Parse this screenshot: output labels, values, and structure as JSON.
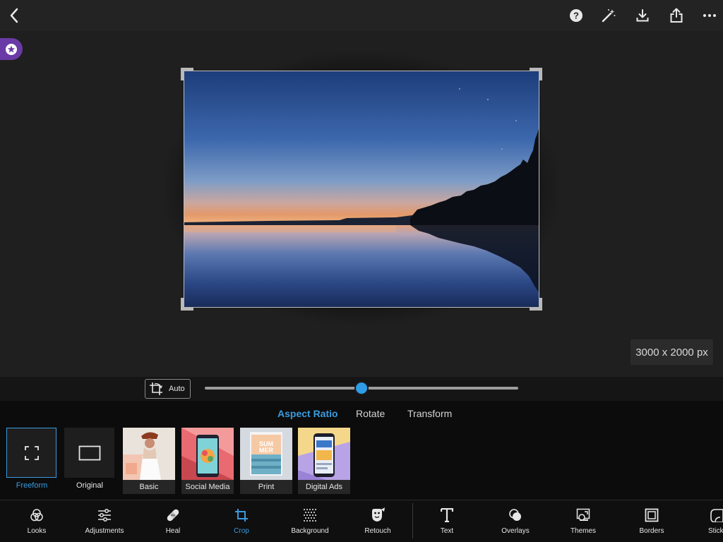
{
  "canvas": {
    "image_dimensions": "3000 x 2000 px"
  },
  "straighten": {
    "auto_label": "Auto",
    "slider_value": 0.5
  },
  "crop_tabs": [
    {
      "label": "Aspect Ratio",
      "active": true
    },
    {
      "label": "Rotate",
      "active": false
    },
    {
      "label": "Transform",
      "active": false
    }
  ],
  "ratios": [
    {
      "label": "Freeform",
      "selected": true
    },
    {
      "label": "Original",
      "selected": false
    }
  ],
  "presets": [
    {
      "label": "Basic"
    },
    {
      "label": "Social Media"
    },
    {
      "label": "Print"
    },
    {
      "label": "Digital Ads"
    }
  ],
  "preset_art": {
    "print_poster_text_1": "SUM",
    "print_poster_text_2": "MER"
  },
  "tools": [
    {
      "label": "Looks",
      "icon": "looks-icon"
    },
    {
      "label": "Adjustments",
      "icon": "adjustments-icon"
    },
    {
      "label": "Heal",
      "icon": "bandage-icon"
    },
    {
      "label": "Crop",
      "icon": "crop-icon",
      "active": true
    },
    {
      "label": "Background",
      "icon": "background-icon"
    },
    {
      "label": "Retouch",
      "icon": "retouch-icon"
    },
    {
      "label": "Text",
      "icon": "text-icon"
    },
    {
      "label": "Overlays",
      "icon": "overlays-icon"
    },
    {
      "label": "Themes",
      "icon": "themes-icon"
    },
    {
      "label": "Borders",
      "icon": "borders-icon"
    },
    {
      "label": "Stick",
      "icon": "stickers-icon"
    }
  ],
  "colors": {
    "accent": "#3a9bdf",
    "slider_thumb": "#2e9ce6",
    "premium": "#6a3aa6"
  }
}
